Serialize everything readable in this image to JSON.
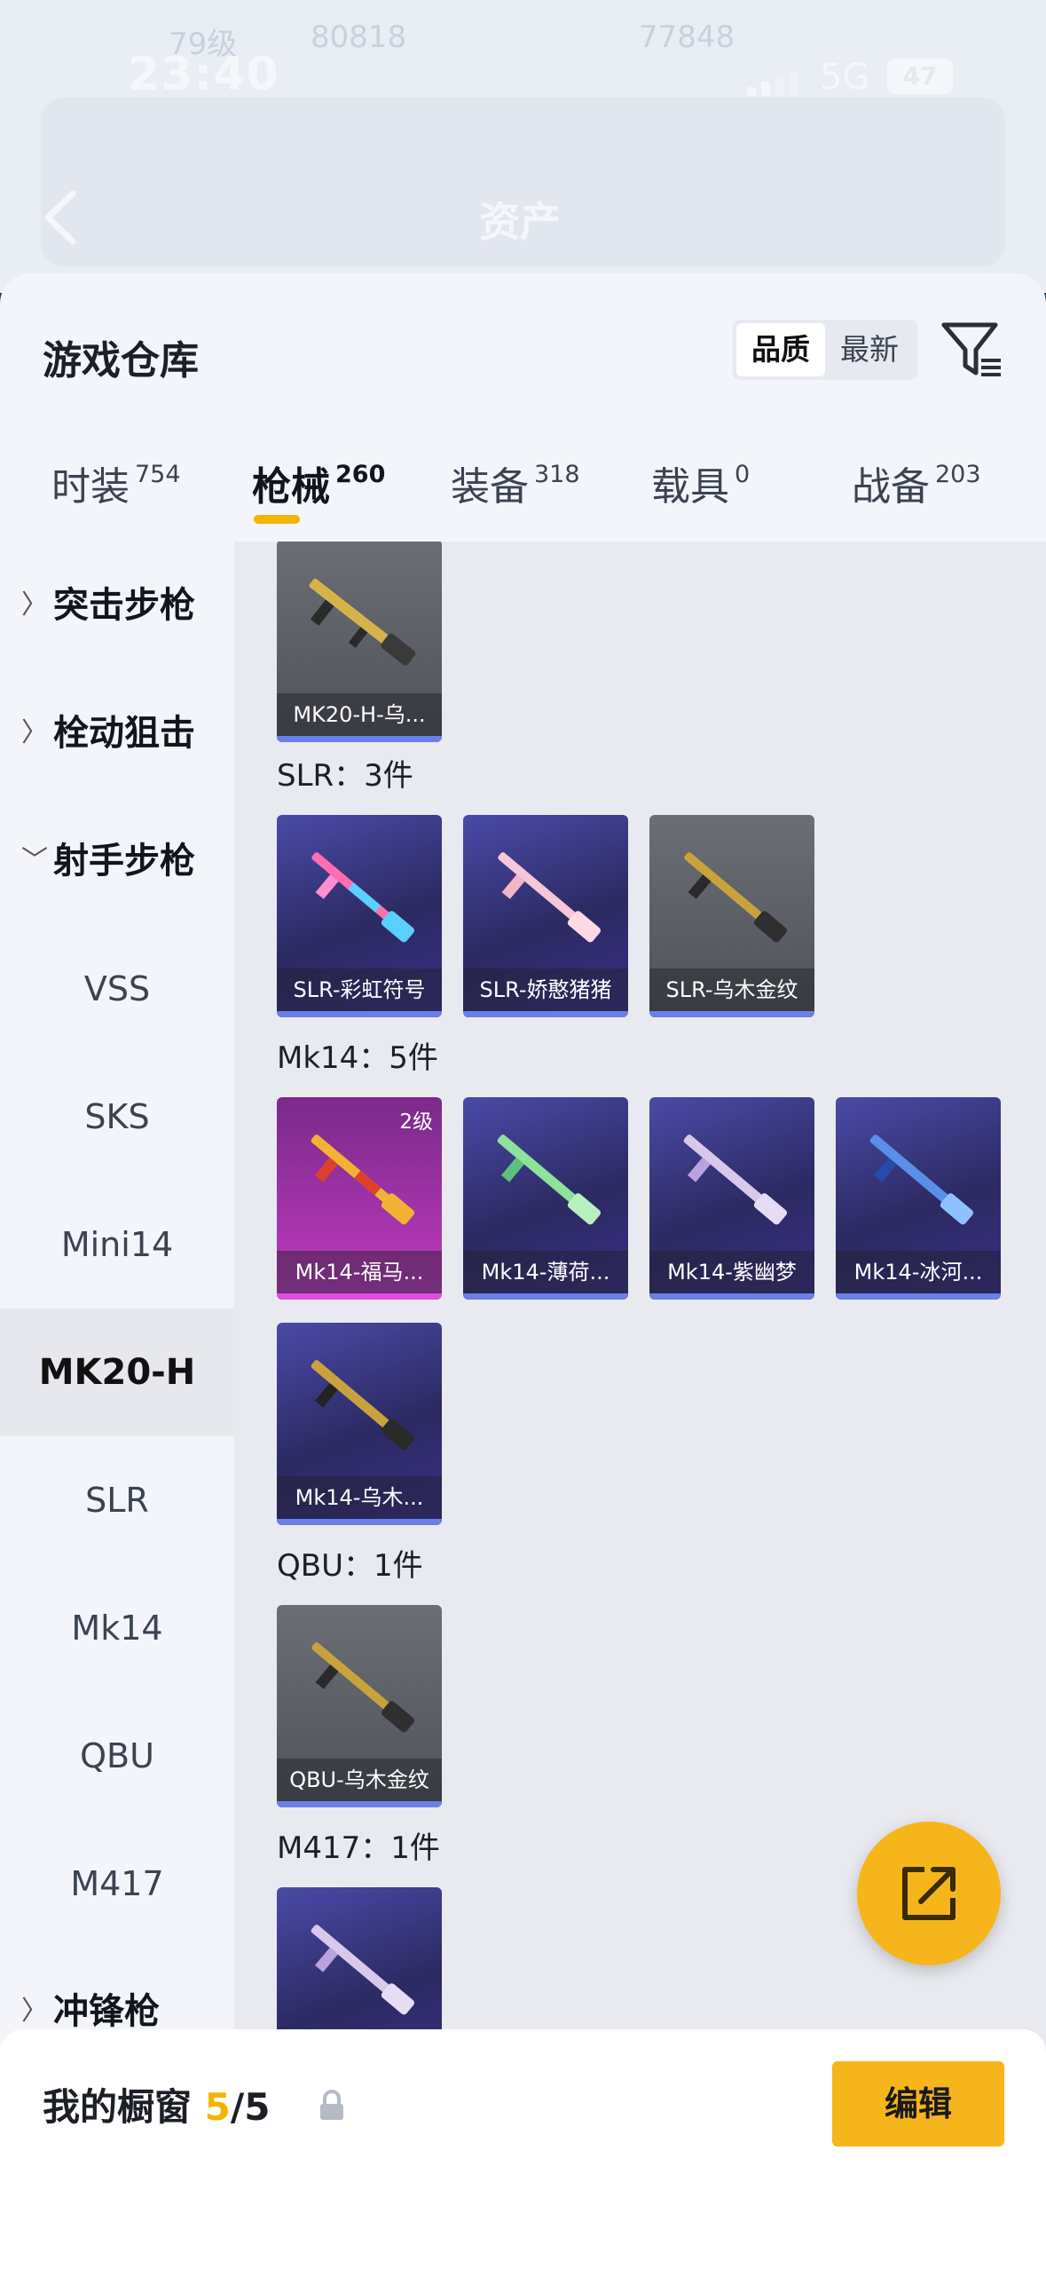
{
  "status": {
    "time": "23:40",
    "network": "5G",
    "battery": "47"
  },
  "header": {
    "title": "资产",
    "ghost": [
      "79级",
      "80818",
      "77848"
    ]
  },
  "sheet": {
    "title": "游戏仓库",
    "sort": {
      "options": [
        "品质",
        "最新"
      ],
      "active": "品质"
    }
  },
  "tabs": [
    {
      "label": "时装",
      "count": "754"
    },
    {
      "label": "枪械",
      "count": "260"
    },
    {
      "label": "装备",
      "count": "318"
    },
    {
      "label": "载具",
      "count": "0"
    },
    {
      "label": "战备",
      "count": "203"
    }
  ],
  "active_tab": "枪械",
  "sidebar": {
    "items": [
      {
        "label": "突击步枪",
        "type": "group",
        "expanded": false
      },
      {
        "label": "栓动狙击",
        "type": "group",
        "expanded": false
      },
      {
        "label": "射手步枪",
        "type": "group",
        "expanded": true
      },
      {
        "label": "VSS",
        "type": "sub"
      },
      {
        "label": "SKS",
        "type": "sub"
      },
      {
        "label": "Mini14",
        "type": "sub"
      },
      {
        "label": "MK20-H",
        "type": "sub",
        "active": true
      },
      {
        "label": "SLR",
        "type": "sub"
      },
      {
        "label": "Mk14",
        "type": "sub"
      },
      {
        "label": "QBU",
        "type": "sub"
      },
      {
        "label": "M417",
        "type": "sub"
      },
      {
        "label": "冲锋枪",
        "type": "group",
        "expanded": false
      }
    ]
  },
  "sections": [
    {
      "title": "",
      "items": [
        {
          "label": "MK20-H-乌...",
          "rarity": "gray"
        }
      ]
    },
    {
      "title": "SLR：3件",
      "items": [
        {
          "label": "SLR-彩虹符号",
          "rarity": "purple"
        },
        {
          "label": "SLR-娇憨猪猪",
          "rarity": "purple"
        },
        {
          "label": "SLR-乌木金纹",
          "rarity": "gray"
        }
      ]
    },
    {
      "title": "Mk14：5件",
      "items": [
        {
          "label": "Mk14-福马...",
          "rarity": "pink",
          "level": "2级"
        },
        {
          "label": "Mk14-薄荷...",
          "rarity": "purple"
        },
        {
          "label": "Mk14-紫幽梦",
          "rarity": "purple"
        },
        {
          "label": "Mk14-冰河...",
          "rarity": "purple"
        },
        {
          "label": "Mk14-乌木...",
          "rarity": "purple"
        }
      ]
    },
    {
      "title": "QBU：1件",
      "items": [
        {
          "label": "QBU-乌木金纹",
          "rarity": "gray"
        }
      ]
    },
    {
      "title": "M417：1件",
      "items": [
        {
          "label": "",
          "rarity": "purple"
        }
      ]
    }
  ],
  "bottom": {
    "title_prefix": "我的橱窗 ",
    "count_current": "5",
    "count_total": "/5",
    "edit_label": "编辑"
  },
  "colors": {
    "accent": "#f7b51c",
    "tab_indicator": "#f5b400",
    "rarity_purple": "#3a3580",
    "rarity_gray": "#5a5d63",
    "rarity_pink": "#c03ac0"
  }
}
